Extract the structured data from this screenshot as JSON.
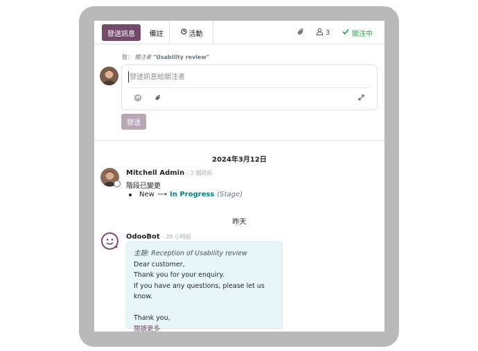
{
  "topbar": {
    "send_message_label": "發送訊息",
    "note_label": "備註",
    "activity_label": "活動",
    "followers_count": "3",
    "following_label": "關注中"
  },
  "composer": {
    "to_prefix": "致：",
    "to_followers": "關注者",
    "to_record": "\"Usability review\"",
    "placeholder": "發送訊息給關注者",
    "send_label": "發送"
  },
  "thread": {
    "date1": "2024年3月12日",
    "msg1": {
      "author": "Mitchell Admin",
      "time": "- 2 個月前",
      "text": "階段已變更",
      "stage_from": "New",
      "arrow": "⟶",
      "stage_to": "In Progress",
      "field": "(Stage)"
    },
    "date2": "昨天",
    "msg2": {
      "author": "OdooBot",
      "time": "- 20 小時前",
      "subject_label": "主題:",
      "subject": "Reception of Usability review",
      "lines": [
        "Dear customer,",
        "Thank you for your enquiry.",
        "If you have any questions, please let us know."
      ],
      "closing": "Thank you,",
      "read_more": "閱讀更多"
    }
  },
  "colors": {
    "brand": "#714b67",
    "following": "#28a745",
    "stage_link": "#017e84",
    "bubble_bg": "#e9f6f8"
  }
}
